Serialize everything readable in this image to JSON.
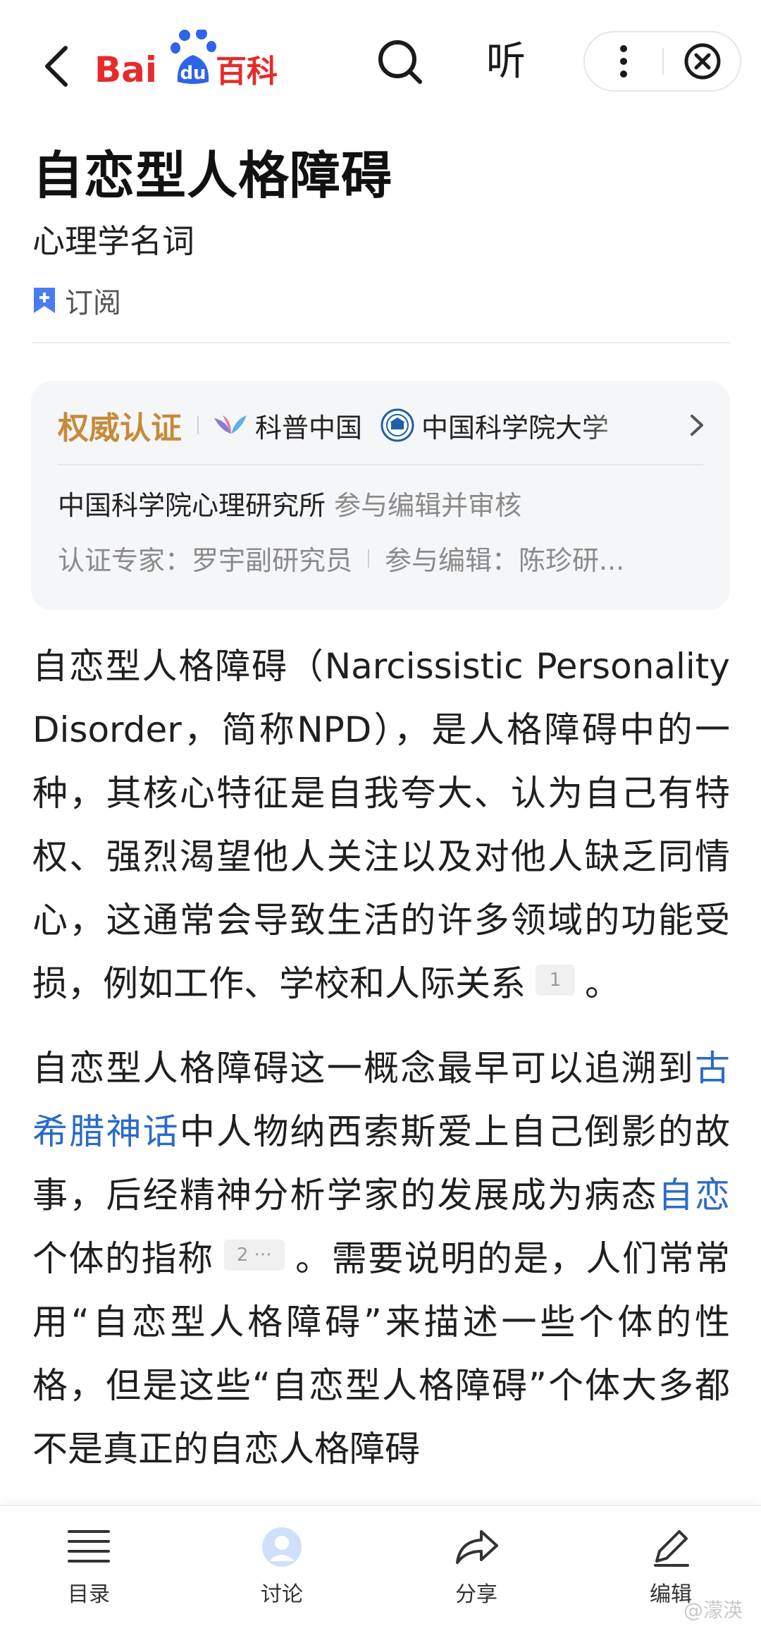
{
  "header": {
    "logo_text_latin": "Bai",
    "logo_text_du": "du",
    "logo_text_cn": "百科",
    "listen_label": "听"
  },
  "article": {
    "title": "自恋型人格障碍",
    "subtitle": "心理学名词",
    "subscribe_label": "订阅"
  },
  "authority": {
    "label": "权威认证",
    "org1": "科普中国",
    "org2": "中国科学院大学",
    "reviewer_org": "中国科学院心理研究所",
    "reviewer_action": "参与编辑并审核",
    "expert_line": "认证专家：罗宇副研究员",
    "editors_line": "参与编辑：陈珍研..."
  },
  "body": {
    "p1": "自恋型人格障碍（Narcissistic Personality Disorder，简称NPD），是人格障碍中的一种，其核心特征是自我夸大、认为自己有特权、强烈渴望他人关注以及对他人缺乏同情心，这通常会导致生活的许多领域的功能受损，例如工作、学校和人际关系",
    "p1_ref": "1",
    "p1_end": "。",
    "p2_a": "自恋型人格障碍这一概念最早可以追溯到",
    "p2_link1": "古希腊神话",
    "p2_b": "中人物纳西索斯爱上自己倒影的故事，后经精神分析学家的发展成为病态",
    "p2_link2": "自恋",
    "p2_c": "个体的指称",
    "p2_ref": "2 ···",
    "p2_d": "。需要说明的是，人们常常用“自恋型人格障碍”来描述一些个体的性格，但是这些“自恋型人格障碍”个体大多都不是真正的自恋人格障碍"
  },
  "bottom_nav": {
    "toc": "目录",
    "discuss": "讨论",
    "share": "分享",
    "edit": "编辑"
  },
  "watermark": "@濛渶",
  "colors": {
    "baidu_red": "#e52b2b",
    "baidu_blue": "#2d64e8",
    "authority_gold": "#c78a3a",
    "link_blue": "#2a6bc8",
    "bookmark_blue": "#4a7cf0"
  }
}
